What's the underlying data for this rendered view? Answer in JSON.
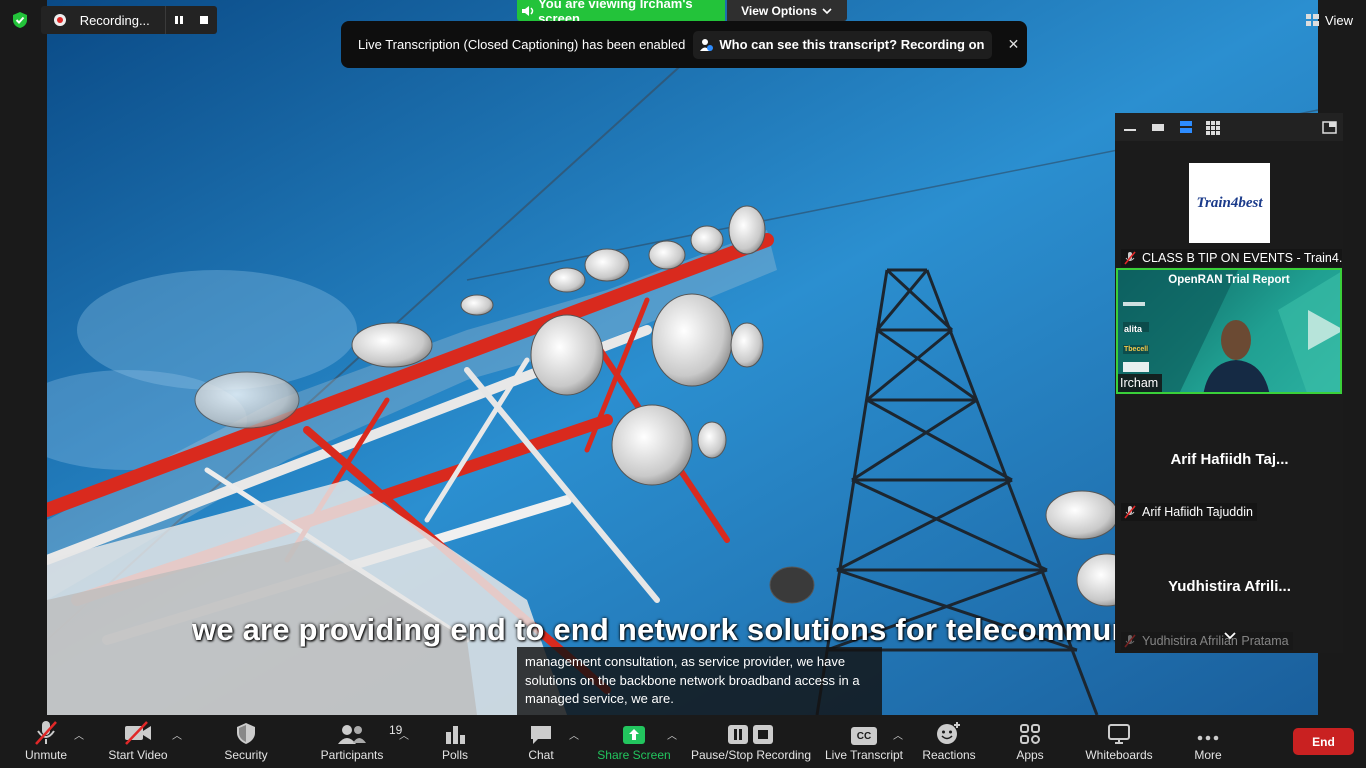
{
  "top_bar": {
    "recording_label": "Recording...",
    "viewing_label": "You are viewing Ircham's screen",
    "view_options_label": "View Options",
    "view_label": "View"
  },
  "notice": {
    "text": "Live Transcription (Closed Captioning) has been enabled",
    "link_label": "Who can see this transcript? Recording on",
    "close_glyph": "✕"
  },
  "shared_screen": {
    "caption": "we are providing end to end network solutions for telecommunica",
    "transcript": "management consultation, as service provider, we have solutions on the backbone network broadband access in a managed service, we are."
  },
  "gallery": {
    "tiles": [
      {
        "name": "CLASS B TIP ON EVENTS - Train4...",
        "logo_text": "Train4best",
        "muted": true
      },
      {
        "name": "Ircham",
        "slide_title": "OpenRAN Trial Report",
        "slide_logos": [
          "alita",
          "Tbecell"
        ],
        "active_speaker": true
      },
      {
        "name": "Arif Hafiidh Tajuddin",
        "display": "Arif  Hafiidh  Taj...",
        "muted": true
      },
      {
        "name": "Yudhistira Afrilian Pratama",
        "display": "Yudhistira  Afrili...",
        "muted": true
      }
    ]
  },
  "toolbar": {
    "items": [
      {
        "label": "Unmute",
        "icon": "mic-off-icon"
      },
      {
        "label": "Start Video",
        "icon": "video-off-icon"
      },
      {
        "label": "Security",
        "icon": "shield-icon"
      },
      {
        "label": "Participants",
        "icon": "participants-icon",
        "count": "19"
      },
      {
        "label": "Polls",
        "icon": "polls-icon"
      },
      {
        "label": "Chat",
        "icon": "chat-icon"
      },
      {
        "label": "Share Screen",
        "icon": "share-screen-icon"
      },
      {
        "label": "Pause/Stop Recording",
        "icon": "pause-stop-icon"
      },
      {
        "label": "Live Transcript",
        "icon": "cc-icon",
        "cc_text": "CC"
      },
      {
        "label": "Reactions",
        "icon": "reactions-icon"
      },
      {
        "label": "Apps",
        "icon": "apps-icon"
      },
      {
        "label": "Whiteboards",
        "icon": "whiteboard-icon"
      },
      {
        "label": "More",
        "icon": "more-icon"
      }
    ],
    "end_label": "End"
  },
  "colors": {
    "green_accent": "#23c33a",
    "end_red": "#c92121",
    "share_green": "#22c55e",
    "muted_red": "#e02828"
  }
}
